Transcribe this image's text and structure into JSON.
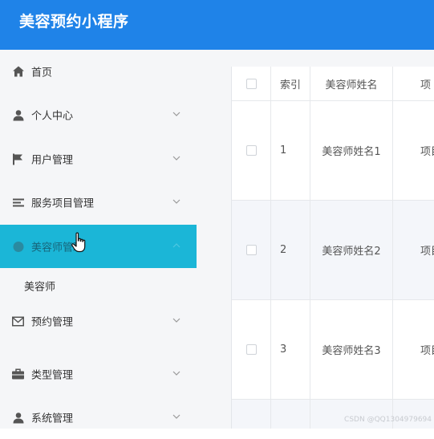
{
  "app": {
    "title": "美容预约小程序"
  },
  "sidebar": {
    "items": [
      {
        "label": "首页",
        "icon": "home-icon"
      },
      {
        "label": "个人中心",
        "icon": "user-icon"
      },
      {
        "label": "用户管理",
        "icon": "flag-icon"
      },
      {
        "label": "服务项目管理",
        "icon": "list-icon"
      },
      {
        "label": "美容师管理",
        "icon": "circle-icon",
        "active": true
      },
      {
        "label": "预约管理",
        "icon": "mail-icon"
      },
      {
        "label": "类型管理",
        "icon": "briefcase-icon"
      },
      {
        "label": "系统管理",
        "icon": "user-icon"
      }
    ],
    "submenu": {
      "label": "美容师"
    }
  },
  "table": {
    "headers": {
      "index": "索引",
      "name": "美容师姓名",
      "item": "项"
    },
    "rows": [
      {
        "index": "1",
        "name": "美容师姓名1",
        "item": "项目"
      },
      {
        "index": "2",
        "name": "美容师姓名2",
        "item": "项目"
      },
      {
        "index": "3",
        "name": "美容师姓名3",
        "item": "项目"
      }
    ]
  },
  "watermark": "CSDN @QQ1304979694",
  "colors": {
    "topbar": "#1f83e8",
    "active_menu": "#1bb6d7",
    "sidebar_bg": "#f5f6f8"
  }
}
